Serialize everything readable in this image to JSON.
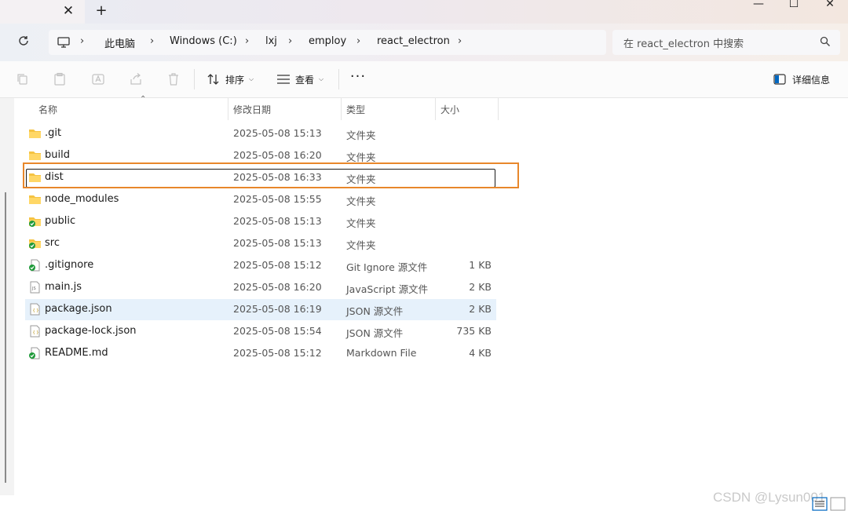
{
  "window": {
    "tab_close": "✕",
    "tab_add": "+",
    "minimize": "—",
    "maximize": "☐",
    "close": "✕"
  },
  "address": {
    "crumbs": [
      "此电脑",
      "Windows (C:)",
      "lxj",
      "employ",
      "react_electron"
    ],
    "separator": "›"
  },
  "search": {
    "placeholder": "在 react_electron 中搜索"
  },
  "toolbar": {
    "sort_label": "排序",
    "view_label": "查看",
    "more_label": "···",
    "details_label": "详细信息"
  },
  "columns": {
    "name": "名称",
    "date": "修改日期",
    "type": "类型",
    "size": "大小"
  },
  "files": [
    {
      "name": ".git",
      "date": "2025-05-08 15:13",
      "type": "文件夹",
      "size": "",
      "icon": "folder-icon"
    },
    {
      "name": "build",
      "date": "2025-05-08 16:20",
      "type": "文件夹",
      "size": "",
      "icon": "folder-icon"
    },
    {
      "name": "dist",
      "date": "2025-05-08 16:33",
      "type": "文件夹",
      "size": "",
      "icon": "folder-icon"
    },
    {
      "name": "node_modules",
      "date": "2025-05-08 15:55",
      "type": "文件夹",
      "size": "",
      "icon": "folder-icon"
    },
    {
      "name": "public",
      "date": "2025-05-08 15:13",
      "type": "文件夹",
      "size": "",
      "icon": "folder-synced-icon"
    },
    {
      "name": "src",
      "date": "2025-05-08 15:13",
      "type": "文件夹",
      "size": "",
      "icon": "folder-synced-icon"
    },
    {
      "name": ".gitignore",
      "date": "2025-05-08 15:12",
      "type": "Git Ignore 源文件",
      "size": "1 KB",
      "icon": "file-synced-icon"
    },
    {
      "name": "main.js",
      "date": "2025-05-08 16:20",
      "type": "JavaScript 源文件",
      "size": "2 KB",
      "icon": "js-file-icon"
    },
    {
      "name": "package.json",
      "date": "2025-05-08 16:19",
      "type": "JSON 源文件",
      "size": "2 KB",
      "icon": "json-file-icon"
    },
    {
      "name": "package-lock.json",
      "date": "2025-05-08 15:54",
      "type": "JSON 源文件",
      "size": "735 KB",
      "icon": "json-file-icon"
    },
    {
      "name": "README.md",
      "date": "2025-05-08 15:12",
      "type": "Markdown File",
      "size": "4 KB",
      "icon": "file-synced-icon"
    }
  ],
  "watermark": "CSDN @Lysun001",
  "colors": {
    "highlight": "#e8872b",
    "selected": "#e6f1fb",
    "folder": "#f5c342"
  }
}
